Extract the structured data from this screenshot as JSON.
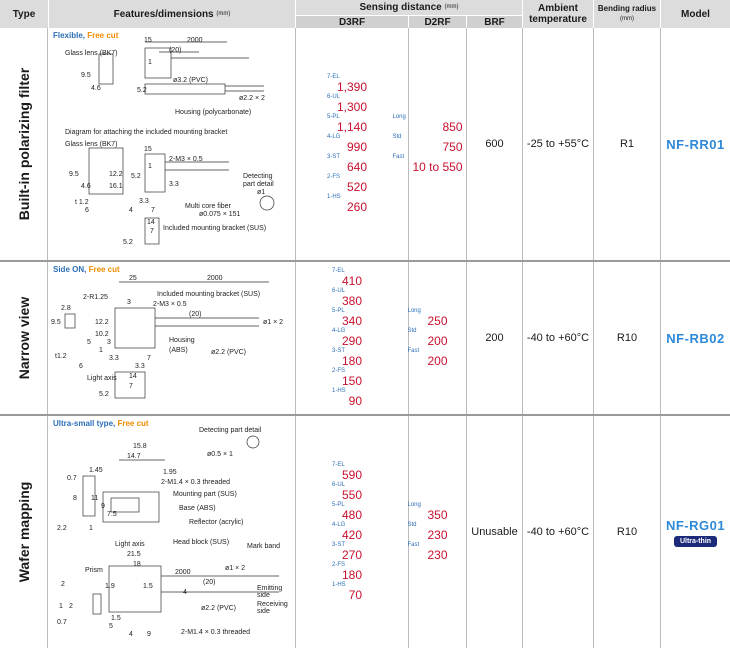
{
  "header": {
    "type": "Type",
    "features": "Features/dimensions",
    "features_unit": "(mm)",
    "sensing": "Sensing distance",
    "sensing_unit": "(mm)",
    "d3rf": "D3RF",
    "d2rf": "D2RF",
    "brf": "BRF",
    "ambient_1": "Ambient",
    "ambient_2": "temperature",
    "bending_1": "Bending radius",
    "bending_unit": "(mm)",
    "model": "Model"
  },
  "rows": [
    {
      "type": "Built-in polarizing filter",
      "tag_a": "Flexible, ",
      "tag_b": "Free cut",
      "figure_labels": {
        "glass_lens_1": "Glass lens (BK7)",
        "d15": "15",
        "d2000": "2000",
        "d20": "(20)",
        "d1": "1",
        "phi32": "ø3.2 (PVC)",
        "d95": "9.5",
        "d46": "4.6",
        "d52": "5.2",
        "phi22x2": "ø2.2 × 2",
        "housing": "Housing (polycarbonate)",
        "diagram": "Diagram for attaching the included mounting bracket",
        "glass_lens_2": "Glass lens (BK7)",
        "d15b": "15",
        "m3": "2-M3 × 0.5",
        "d1b": "1",
        "d95b": "9.5",
        "d46b": "4.6",
        "d122": "12.2",
        "d52b": "5.2",
        "d161": "16.1",
        "d33": "3.3",
        "d33b": "3.3",
        "t12": "t 1.2",
        "d6": "6",
        "d4": "4",
        "d7": "7",
        "det": "Detecting",
        "det2": "part detail",
        "phi1": "ø1",
        "multicore": "Multi core fiber",
        "phi0075": "ø0.075 × 151",
        "d14": "14",
        "d7b": "7",
        "d52c": "5.2",
        "bracket": "Included mounting bracket (SUS)"
      },
      "d3rf": [
        {
          "mode": "7-EL",
          "value": "1,390"
        },
        {
          "mode": "6-UL",
          "value": "1,300"
        },
        {
          "mode": "5-PL",
          "value": "1,140"
        },
        {
          "mode": "4-LG",
          "value": "990"
        },
        {
          "mode": "3-ST",
          "value": "640"
        },
        {
          "mode": "2-FS",
          "value": "520"
        },
        {
          "mode": "1-HS",
          "value": "260"
        }
      ],
      "d2rf": [
        {
          "mode": "Long",
          "value": "850"
        },
        {
          "mode": "Std",
          "value": "750"
        },
        {
          "mode": "Fast",
          "value": "10 to 550"
        }
      ],
      "brf": "600",
      "ambient": "-25 to +55°C",
      "bending": "R1",
      "model": "NF-RR01",
      "badge": ""
    },
    {
      "type": "Narrow view",
      "tag_a": "Side ON, ",
      "tag_b": "Free cut",
      "figure_labels": {
        "d25": "25",
        "d2000": "2000",
        "d2r": "2-R1.25",
        "d3": "3",
        "d28": "2.8",
        "bracket": "Included mounting bracket (SUS)",
        "m3": "2-M3 × 0.5",
        "d20": "(20)",
        "phi1x2": "ø1 × 2",
        "d95": "9.5",
        "d122": "12.2",
        "d102": "10.2",
        "d5": "5",
        "d3b": "3",
        "d1": "1",
        "housing": "Housing",
        "abs": "(ABS)",
        "phi22": "ø2.2 (PVC)",
        "t12": "t1.2",
        "d6": "6",
        "d33": "3.3",
        "d33b": "3.3",
        "d7": "7",
        "light_axis": "Light axis",
        "d14": "14",
        "d7b": "7",
        "d52": "5.2"
      },
      "d3rf": [
        {
          "mode": "7-EL",
          "value": "410"
        },
        {
          "mode": "6-UL",
          "value": "380"
        },
        {
          "mode": "5-PL",
          "value": "340"
        },
        {
          "mode": "4-LG",
          "value": "290"
        },
        {
          "mode": "3-ST",
          "value": "180"
        },
        {
          "mode": "2-FS",
          "value": "150"
        },
        {
          "mode": "1-HS",
          "value": "90"
        }
      ],
      "d2rf": [
        {
          "mode": "Long",
          "value": "250"
        },
        {
          "mode": "Std",
          "value": "200"
        },
        {
          "mode": "Fast",
          "value": "200"
        }
      ],
      "brf": "200",
      "ambient": "-40 to +60°C",
      "bending": "R10",
      "model": "NF-RB02",
      "badge": ""
    },
    {
      "type": "Wafer mapping",
      "tag_a": "Ultra-small type, ",
      "tag_b": "Free cut",
      "figure_labels": {
        "det": "Detecting part detail",
        "phi05": "ø0.5 × 1",
        "d158": "15.8",
        "d147": "14.7",
        "d07": "0.7",
        "d145": "1.45",
        "d195": "1.95",
        "m14": "2-M1.4 × 0.3 threaded",
        "mount": "Mounting part (SUS)",
        "d8": "8",
        "d11": "11",
        "d9": "9",
        "d75": "7.5",
        "base": "Base (ABS)",
        "reflector": "Reflector (acrylic)",
        "d22": "2.2",
        "d1": "1",
        "light_axis": "Light axis",
        "head": "Head block (SUS)",
        "mark": "Mark band",
        "d215": "21.5",
        "d18": "18",
        "prism": "Prism",
        "d2": "2",
        "d19": "1.9",
        "d15": "1.5",
        "d2000": "2000",
        "phi1x2": "ø1 × 2",
        "d20": "(20)",
        "d4": "4",
        "emit": "Emitting",
        "emit2": "side",
        "phi22": "ø2.2 (PVC)",
        "recv": "Receiving",
        "recv2": "side",
        "d1b": "1",
        "d2b": "2",
        "d07b": "0.7",
        "d15b": "1.5",
        "d5": "5",
        "d4b": "4",
        "d9b": "9",
        "m14b": "2-M1.4 × 0.3 threaded"
      },
      "d3rf": [
        {
          "mode": "7-EL",
          "value": "590"
        },
        {
          "mode": "6-UL",
          "value": "550"
        },
        {
          "mode": "5-PL",
          "value": "480"
        },
        {
          "mode": "4-LG",
          "value": "420"
        },
        {
          "mode": "3-ST",
          "value": "270"
        },
        {
          "mode": "2-FS",
          "value": "180"
        },
        {
          "mode": "1-HS",
          "value": "70"
        }
      ],
      "d2rf": [
        {
          "mode": "Long",
          "value": "350"
        },
        {
          "mode": "Std",
          "value": "230"
        },
        {
          "mode": "Fast",
          "value": "230"
        }
      ],
      "brf": "Unusable",
      "ambient": "-40 to +60°C",
      "bending": "R10",
      "model": "NF-RG01",
      "badge": "Ultra-thin"
    }
  ]
}
